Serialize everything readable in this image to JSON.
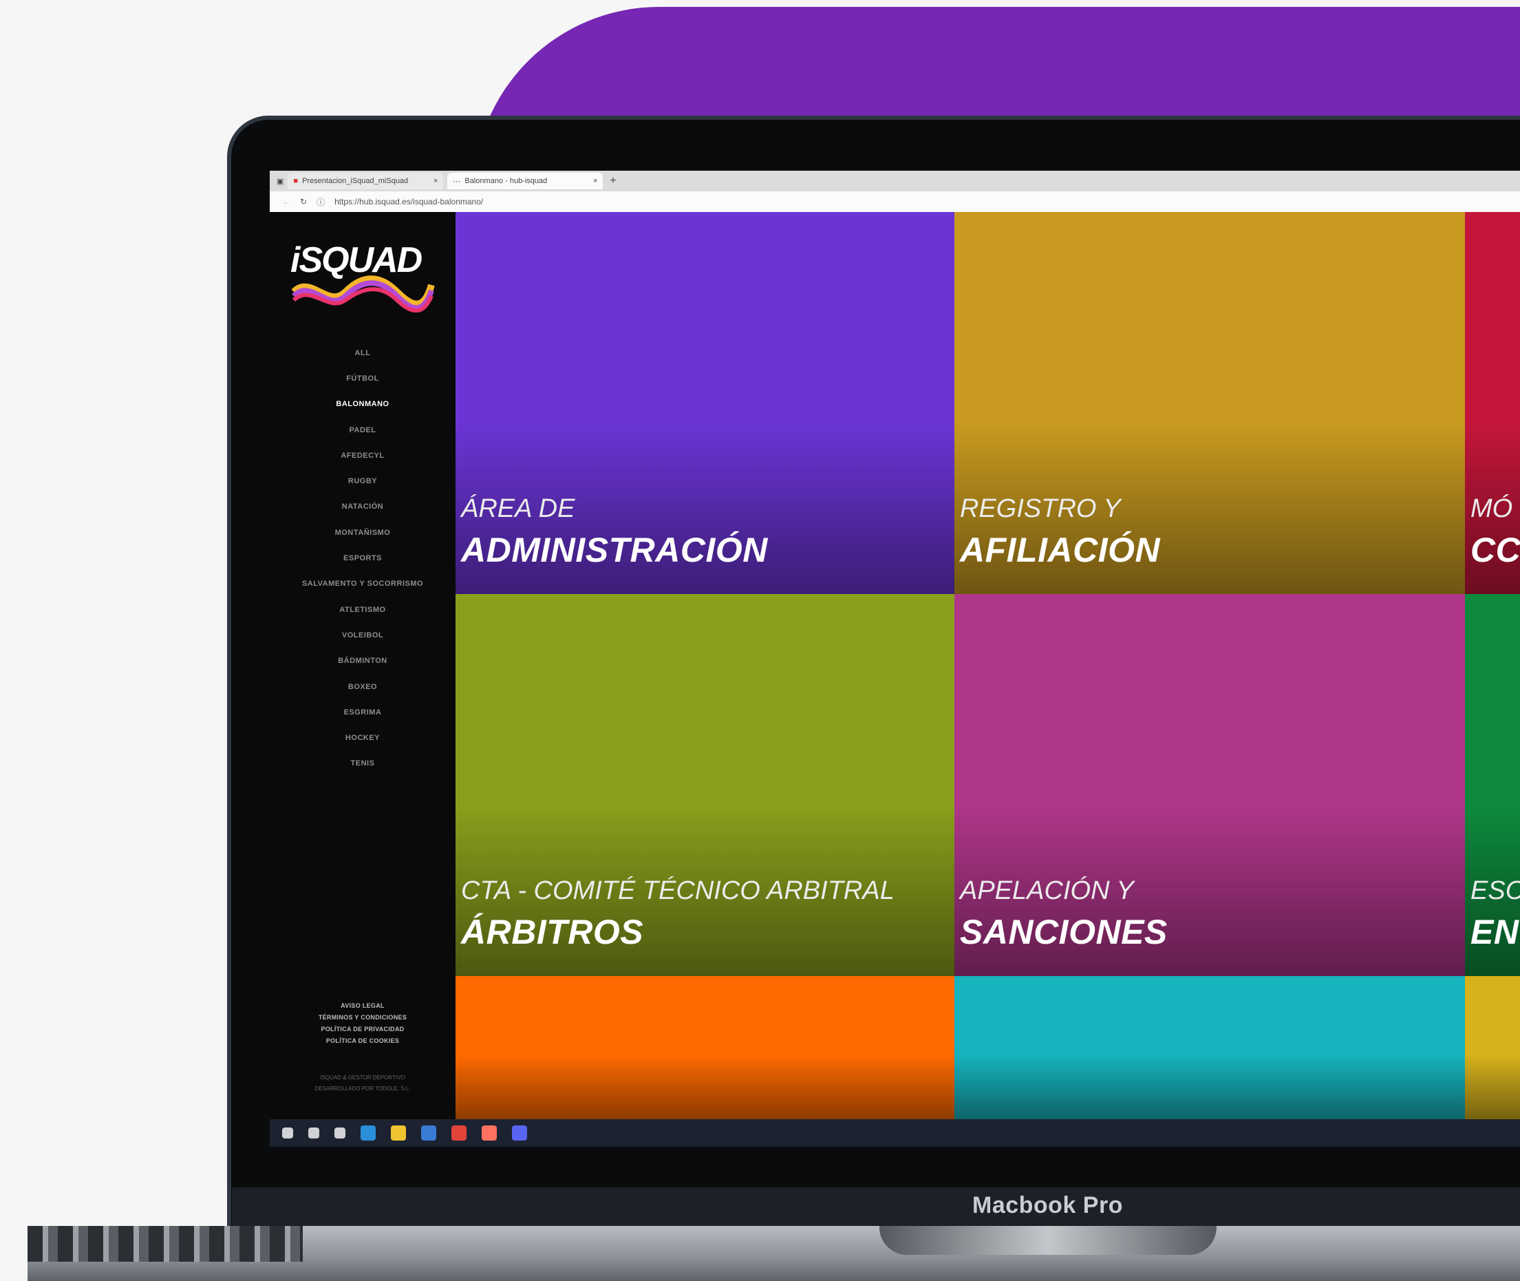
{
  "device": {
    "label": "Macbook Pro"
  },
  "browser": {
    "tabs": [
      {
        "label": "Presentacion_iSquad_miSquad",
        "close": "×"
      },
      {
        "label": "Balonmano - hub-isquad",
        "close": "×"
      }
    ],
    "new_tab": "+",
    "url": "https://hub.isquad.es/isquad-balonmano/"
  },
  "site": {
    "logo_text": "iSQUAD",
    "nav": [
      "ALL",
      "FÚTBOL",
      "BALONMANO",
      "PADEL",
      "AFEDECYL",
      "RUGBY",
      "NATACIÓN",
      "MONTAÑISMO",
      "ESPORTS",
      "SALVAMENTO Y SOCORRISMO",
      "ATLETISMO",
      "VOLEIBOL",
      "BÁDMINTON",
      "BOXEO",
      "ESGRIMA",
      "HOCKEY",
      "TENIS"
    ],
    "active_nav": "BALONMANO",
    "legal": [
      "AVISO LEGAL",
      "TÉRMINOS Y CONDICIONES",
      "POLÍTICA DE PRIVACIDAD",
      "POLÍTICA DE COOKIES"
    ],
    "credits": [
      "ISQUAD & GESTOR DEPORTIVO",
      "DESARROLLADO POR TODOLE, S.L."
    ]
  },
  "tiles": [
    {
      "line1": "ÁREA DE",
      "line2": "ADMINISTRACIÓN",
      "color": "#6b35d6"
    },
    {
      "line1": "REGISTRO Y",
      "line2": "AFILIACIÓN",
      "color": "#c89a1f"
    },
    {
      "line1": "MÓ",
      "line2": "CC",
      "color": "#c4163a"
    },
    {
      "line1": "CTA - COMITÉ TÉCNICO ARBITRAL",
      "line2": "ÁRBITROS",
      "color": "#8aa01c"
    },
    {
      "line1": "APELACIÓN Y",
      "line2": "SANCIONES",
      "color": "#b0368a"
    },
    {
      "line1": "ESC",
      "line2": "EN",
      "color": "#0e8a3e"
    },
    {
      "line1": "",
      "line2": "",
      "color": "#ff6a00"
    },
    {
      "line1": "",
      "line2": "",
      "color": "#17b4bd"
    },
    {
      "line1": "",
      "line2": "",
      "color": "#d6b21c"
    }
  ],
  "taskbar": {
    "icons": [
      "windows-start-icon",
      "search-icon",
      "task-view-icon",
      "edge-icon",
      "file-explorer-icon",
      "mail-icon",
      "chrome-icon",
      "figma-icon",
      "discord-icon"
    ]
  }
}
